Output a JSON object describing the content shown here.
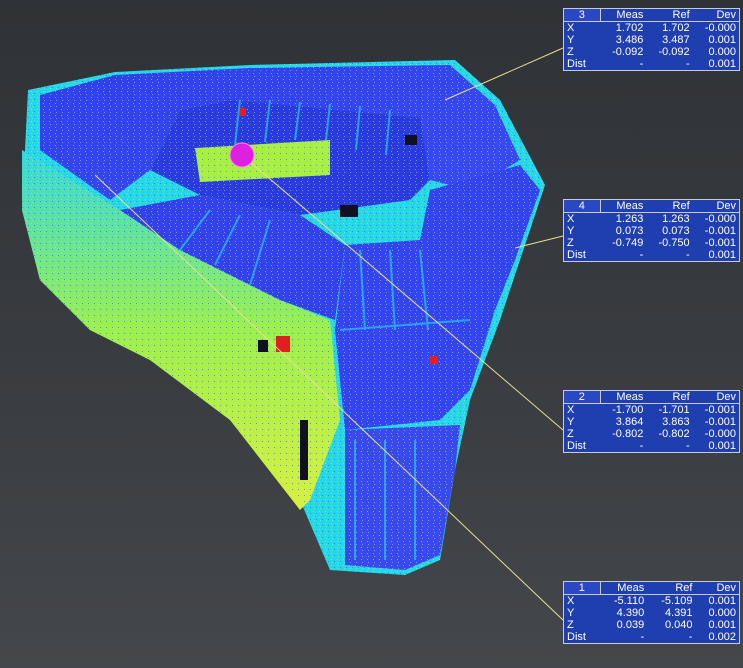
{
  "viewer": {
    "marker_color": "#e020e0",
    "leader_color": "#e8e090",
    "panel_bg": "#1f3fb0"
  },
  "panels": [
    {
      "id": "3",
      "headers": [
        "Meas",
        "Ref",
        "Dev"
      ],
      "rows": [
        {
          "label": "X",
          "meas": "1.702",
          "ref": "1.702",
          "dev": "-0.000"
        },
        {
          "label": "Y",
          "meas": "3.486",
          "ref": "3.487",
          "dev": "0.001"
        },
        {
          "label": "Z",
          "meas": "-0.092",
          "ref": "-0.092",
          "dev": "0.000"
        },
        {
          "label": "Dist",
          "meas": "-",
          "ref": "-",
          "dev": "0.001"
        }
      ]
    },
    {
      "id": "4",
      "headers": [
        "Meas",
        "Ref",
        "Dev"
      ],
      "rows": [
        {
          "label": "X",
          "meas": "1.263",
          "ref": "1.263",
          "dev": "-0.000"
        },
        {
          "label": "Y",
          "meas": "0.073",
          "ref": "0.073",
          "dev": "-0.001"
        },
        {
          "label": "Z",
          "meas": "-0.749",
          "ref": "-0.750",
          "dev": "-0.001"
        },
        {
          "label": "Dist",
          "meas": "-",
          "ref": "-",
          "dev": "0.001"
        }
      ]
    },
    {
      "id": "2",
      "headers": [
        "Meas",
        "Ref",
        "Dev"
      ],
      "rows": [
        {
          "label": "X",
          "meas": "-1.700",
          "ref": "-1.701",
          "dev": "-0.001"
        },
        {
          "label": "Y",
          "meas": "3.864",
          "ref": "3.863",
          "dev": "-0.001"
        },
        {
          "label": "Z",
          "meas": "-0.802",
          "ref": "-0.802",
          "dev": "-0.000"
        },
        {
          "label": "Dist",
          "meas": "-",
          "ref": "-",
          "dev": "0.001"
        }
      ]
    },
    {
      "id": "1",
      "headers": [
        "Meas",
        "Ref",
        "Dev"
      ],
      "rows": [
        {
          "label": "X",
          "meas": "-5.110",
          "ref": "-5.109",
          "dev": "0.001"
        },
        {
          "label": "Y",
          "meas": "4.390",
          "ref": "4.391",
          "dev": "0.000"
        },
        {
          "label": "Z",
          "meas": "0.039",
          "ref": "0.040",
          "dev": "0.001"
        },
        {
          "label": "Dist",
          "meas": "-",
          "ref": "-",
          "dev": "0.002"
        }
      ]
    }
  ]
}
